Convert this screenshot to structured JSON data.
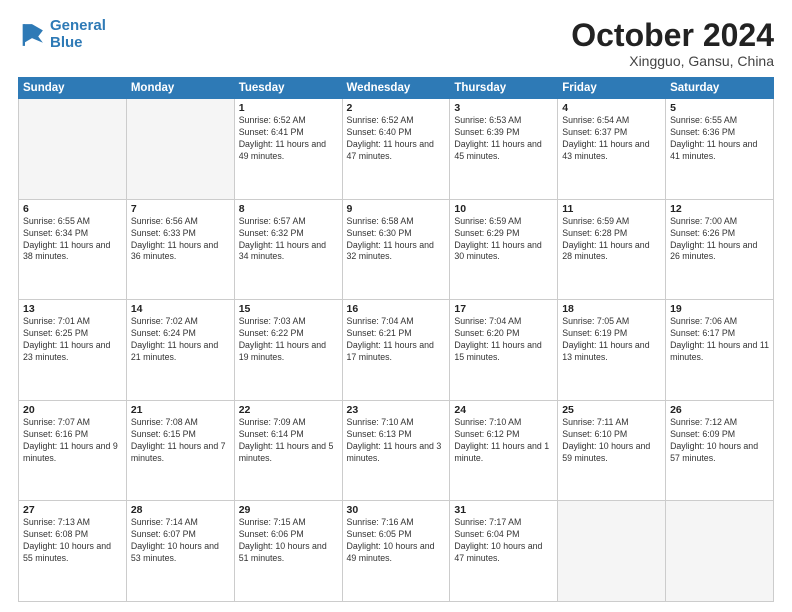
{
  "header": {
    "logo_line1": "General",
    "logo_line2": "Blue",
    "month": "October 2024",
    "location": "Xingguo, Gansu, China"
  },
  "weekdays": [
    "Sunday",
    "Monday",
    "Tuesday",
    "Wednesday",
    "Thursday",
    "Friday",
    "Saturday"
  ],
  "weeks": [
    [
      {
        "day": "",
        "info": ""
      },
      {
        "day": "",
        "info": ""
      },
      {
        "day": "1",
        "info": "Sunrise: 6:52 AM\nSunset: 6:41 PM\nDaylight: 11 hours and 49 minutes."
      },
      {
        "day": "2",
        "info": "Sunrise: 6:52 AM\nSunset: 6:40 PM\nDaylight: 11 hours and 47 minutes."
      },
      {
        "day": "3",
        "info": "Sunrise: 6:53 AM\nSunset: 6:39 PM\nDaylight: 11 hours and 45 minutes."
      },
      {
        "day": "4",
        "info": "Sunrise: 6:54 AM\nSunset: 6:37 PM\nDaylight: 11 hours and 43 minutes."
      },
      {
        "day": "5",
        "info": "Sunrise: 6:55 AM\nSunset: 6:36 PM\nDaylight: 11 hours and 41 minutes."
      }
    ],
    [
      {
        "day": "6",
        "info": "Sunrise: 6:55 AM\nSunset: 6:34 PM\nDaylight: 11 hours and 38 minutes."
      },
      {
        "day": "7",
        "info": "Sunrise: 6:56 AM\nSunset: 6:33 PM\nDaylight: 11 hours and 36 minutes."
      },
      {
        "day": "8",
        "info": "Sunrise: 6:57 AM\nSunset: 6:32 PM\nDaylight: 11 hours and 34 minutes."
      },
      {
        "day": "9",
        "info": "Sunrise: 6:58 AM\nSunset: 6:30 PM\nDaylight: 11 hours and 32 minutes."
      },
      {
        "day": "10",
        "info": "Sunrise: 6:59 AM\nSunset: 6:29 PM\nDaylight: 11 hours and 30 minutes."
      },
      {
        "day": "11",
        "info": "Sunrise: 6:59 AM\nSunset: 6:28 PM\nDaylight: 11 hours and 28 minutes."
      },
      {
        "day": "12",
        "info": "Sunrise: 7:00 AM\nSunset: 6:26 PM\nDaylight: 11 hours and 26 minutes."
      }
    ],
    [
      {
        "day": "13",
        "info": "Sunrise: 7:01 AM\nSunset: 6:25 PM\nDaylight: 11 hours and 23 minutes."
      },
      {
        "day": "14",
        "info": "Sunrise: 7:02 AM\nSunset: 6:24 PM\nDaylight: 11 hours and 21 minutes."
      },
      {
        "day": "15",
        "info": "Sunrise: 7:03 AM\nSunset: 6:22 PM\nDaylight: 11 hours and 19 minutes."
      },
      {
        "day": "16",
        "info": "Sunrise: 7:04 AM\nSunset: 6:21 PM\nDaylight: 11 hours and 17 minutes."
      },
      {
        "day": "17",
        "info": "Sunrise: 7:04 AM\nSunset: 6:20 PM\nDaylight: 11 hours and 15 minutes."
      },
      {
        "day": "18",
        "info": "Sunrise: 7:05 AM\nSunset: 6:19 PM\nDaylight: 11 hours and 13 minutes."
      },
      {
        "day": "19",
        "info": "Sunrise: 7:06 AM\nSunset: 6:17 PM\nDaylight: 11 hours and 11 minutes."
      }
    ],
    [
      {
        "day": "20",
        "info": "Sunrise: 7:07 AM\nSunset: 6:16 PM\nDaylight: 11 hours and 9 minutes."
      },
      {
        "day": "21",
        "info": "Sunrise: 7:08 AM\nSunset: 6:15 PM\nDaylight: 11 hours and 7 minutes."
      },
      {
        "day": "22",
        "info": "Sunrise: 7:09 AM\nSunset: 6:14 PM\nDaylight: 11 hours and 5 minutes."
      },
      {
        "day": "23",
        "info": "Sunrise: 7:10 AM\nSunset: 6:13 PM\nDaylight: 11 hours and 3 minutes."
      },
      {
        "day": "24",
        "info": "Sunrise: 7:10 AM\nSunset: 6:12 PM\nDaylight: 11 hours and 1 minute."
      },
      {
        "day": "25",
        "info": "Sunrise: 7:11 AM\nSunset: 6:10 PM\nDaylight: 10 hours and 59 minutes."
      },
      {
        "day": "26",
        "info": "Sunrise: 7:12 AM\nSunset: 6:09 PM\nDaylight: 10 hours and 57 minutes."
      }
    ],
    [
      {
        "day": "27",
        "info": "Sunrise: 7:13 AM\nSunset: 6:08 PM\nDaylight: 10 hours and 55 minutes."
      },
      {
        "day": "28",
        "info": "Sunrise: 7:14 AM\nSunset: 6:07 PM\nDaylight: 10 hours and 53 minutes."
      },
      {
        "day": "29",
        "info": "Sunrise: 7:15 AM\nSunset: 6:06 PM\nDaylight: 10 hours and 51 minutes."
      },
      {
        "day": "30",
        "info": "Sunrise: 7:16 AM\nSunset: 6:05 PM\nDaylight: 10 hours and 49 minutes."
      },
      {
        "day": "31",
        "info": "Sunrise: 7:17 AM\nSunset: 6:04 PM\nDaylight: 10 hours and 47 minutes."
      },
      {
        "day": "",
        "info": ""
      },
      {
        "day": "",
        "info": ""
      }
    ]
  ]
}
